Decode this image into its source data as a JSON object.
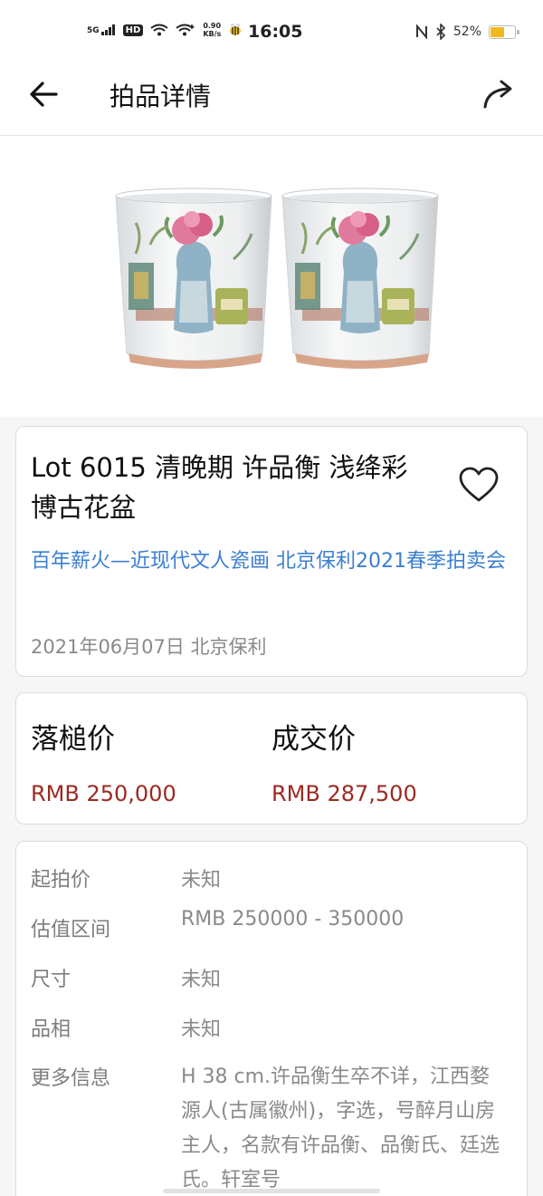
{
  "status_bar": {
    "network": "5G",
    "hd_badge": "HD",
    "speed_value": "0.90",
    "speed_unit": "KB/s",
    "time": "16:05",
    "battery_percent": "52%",
    "battery_level": 0.52
  },
  "navbar": {
    "title": "拍品详情"
  },
  "lot": {
    "title": "Lot 6015 清晚期    许品衡 浅绛彩博古花盆",
    "sale_name": "百年薪火—近现代文人瓷画 北京保利2021春季拍卖会",
    "date_house": "2021年06月07日 北京保利"
  },
  "prices": {
    "hammer_label": "落槌价",
    "hammer_value": "RMB 250,000",
    "deal_label": "成交价",
    "deal_value": "RMB 287,500",
    "accent_color": "#9b2a22"
  },
  "info": {
    "rows": [
      {
        "label": "起拍价",
        "value": "未知"
      },
      {
        "label": "估值区间",
        "value": "RMB 250000 - 350000"
      },
      {
        "label": "尺寸",
        "value": "未知"
      },
      {
        "label": "品相",
        "value": "未知"
      },
      {
        "label": "更多信息",
        "value": "H 38 cm.许品衡生卒不详，江西婺源人(古属徽州)，字选，号醉月山房主人，名款有许品衡、品衡氏、廷选氏。轩室号"
      }
    ]
  },
  "colors": {
    "link": "#3b7fd0",
    "background": "#f6f6f6"
  }
}
